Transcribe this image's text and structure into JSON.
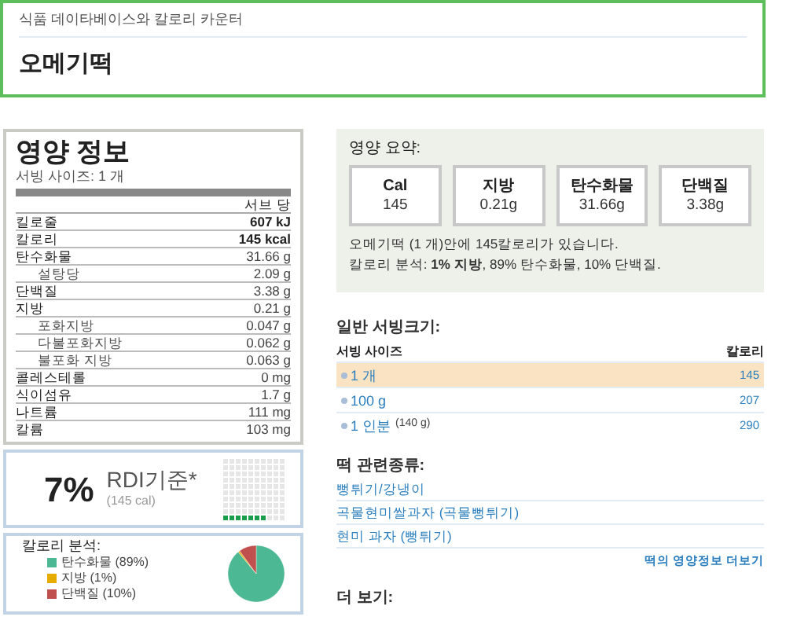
{
  "header": {
    "breadcrumb": "식품 데이타베이스와 칼로리 카운터",
    "title": "오메기떡"
  },
  "nutrition": {
    "title": "영양 정보",
    "serving": "서빙 사이즈: 1 개",
    "per": "서브 당",
    "rows": [
      {
        "label": "킬로줄",
        "value": "607 kJ",
        "sub": false,
        "bold": true
      },
      {
        "label": "칼로리",
        "value": "145 kcal",
        "sub": false,
        "bold": true
      },
      {
        "label": "탄수화물",
        "value": "31.66 g",
        "sub": false,
        "bold": false
      },
      {
        "label": "설탕당",
        "value": "2.09 g",
        "sub": true,
        "bold": false
      },
      {
        "label": "단백질",
        "value": "3.38 g",
        "sub": false,
        "bold": false
      },
      {
        "label": "지방",
        "value": "0.21 g",
        "sub": false,
        "bold": false
      },
      {
        "label": "포화지방",
        "value": "0.047 g",
        "sub": true,
        "bold": false
      },
      {
        "label": "다불포화지방",
        "value": "0.062 g",
        "sub": true,
        "bold": false
      },
      {
        "label": "불포화 지방",
        "value": "0.063 g",
        "sub": true,
        "bold": false
      },
      {
        "label": "콜레스테롤",
        "value": "0 mg",
        "sub": false,
        "bold": false
      },
      {
        "label": "식이섬유",
        "value": "1.7 g",
        "sub": false,
        "bold": false
      },
      {
        "label": "나트륨",
        "value": "111 mg",
        "sub": false,
        "bold": false
      },
      {
        "label": "칼륨",
        "value": "103 mg",
        "sub": false,
        "bold": false
      }
    ]
  },
  "rdi": {
    "percent": "7%",
    "label": "RDI기준*",
    "cal": "(145 cal)"
  },
  "calorie_breakdown": {
    "title": "칼로리 분석:",
    "legend": [
      {
        "color": "#4cb894"
      },
      {
        "color": "#e6ac00"
      },
      {
        "color": "#c0504d"
      }
    ],
    "chart_data": {
      "type": "pie",
      "categories": [
        "탄수화물 (89%)",
        "지방 (1%)",
        "단백질 (10%)"
      ],
      "values": [
        89,
        1,
        10
      ]
    }
  },
  "summary": {
    "title": "영양 요약:",
    "boxes": [
      {
        "label": "Cal",
        "value": "145"
      },
      {
        "label": "지방",
        "value": "0.21g"
      },
      {
        "label": "탄수화물",
        "value": "31.66g"
      },
      {
        "label": "단백질",
        "value": "3.38g"
      }
    ],
    "text1": "오메기떡 (1 개)안에 145칼로리가 있습니다.",
    "text2": "칼로리 분석: **1%** **지방**, 89% 탄수화물, 10% 단백질."
  },
  "servings": {
    "title": "일반 서빙크기:",
    "col_size": "서빙 사이즈",
    "col_cal": "칼로리",
    "rows": [
      {
        "size": "1 개",
        "calories": "145",
        "selected": true
      },
      {
        "size": "100 g",
        "calories": "207",
        "selected": false
      },
      {
        "size": "1 인분",
        "note": "(140 g)",
        "calories": "290",
        "selected": false
      }
    ]
  },
  "related": {
    "title": "떡 관련종류:",
    "links": [
      "뻥튀기/강냉이",
      "곡물현미쌀과자 (곡물뻥튀기)",
      "현미 과자 (뻥튀기)"
    ],
    "more_link": "떡의 영양정보 더보기"
  },
  "see_more": {
    "title": "더 보기:"
  }
}
